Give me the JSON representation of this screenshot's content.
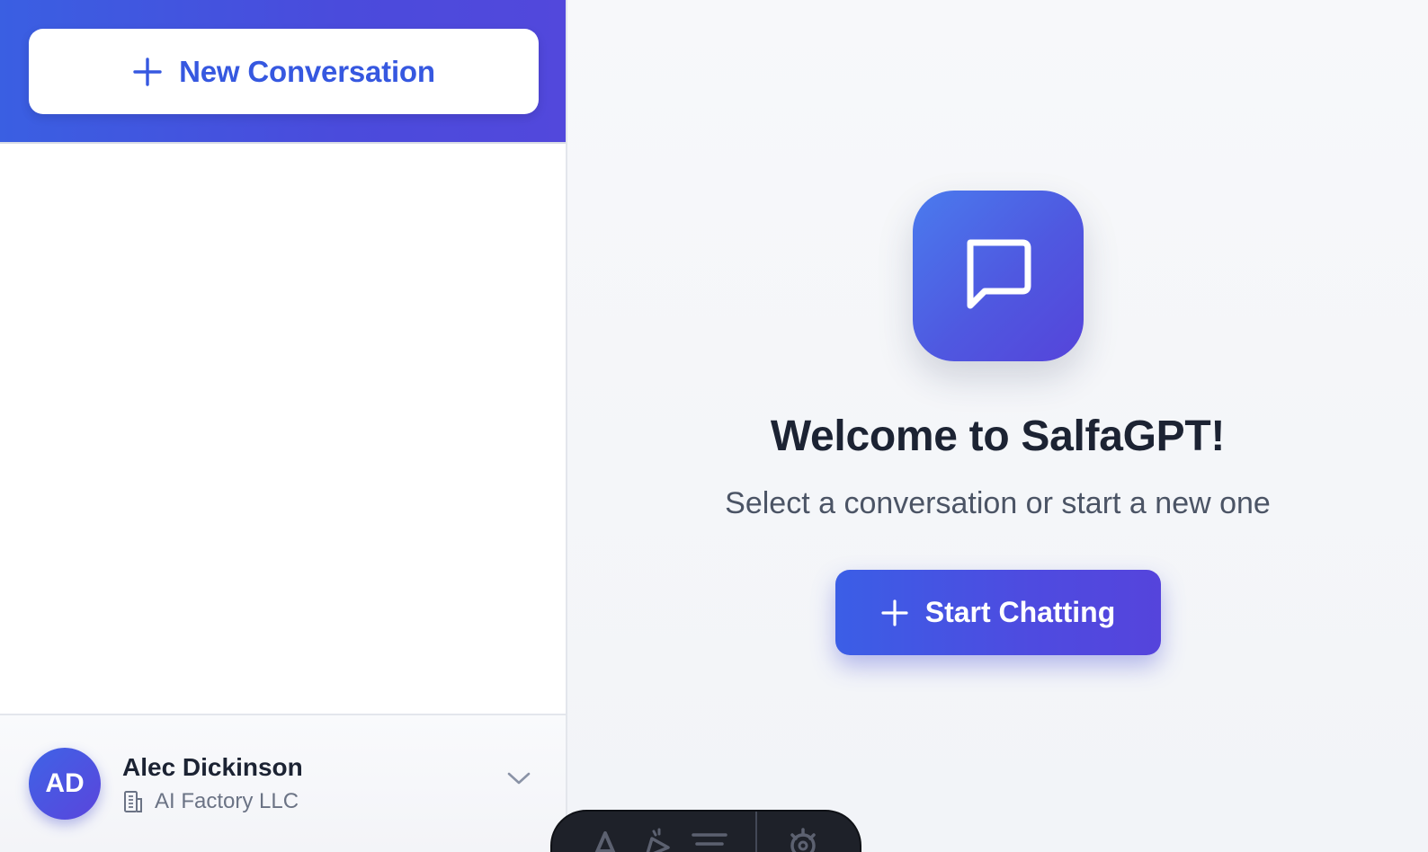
{
  "sidebar": {
    "new_conversation_label": "New Conversation",
    "user": {
      "initials": "AD",
      "name": "Alec Dickinson",
      "organization": "AI Factory LLC"
    }
  },
  "main": {
    "welcome_title": "Welcome to SalfaGPT!",
    "welcome_subtitle": "Select a conversation or start a new one",
    "start_button_label": "Start Chatting"
  },
  "icons": {
    "new_conversation": "plus-icon",
    "start_chatting": "plus-icon",
    "logo": "chat-bubble-icon",
    "organization": "building-icon",
    "user_menu": "chevron-down-icon",
    "toolbar": [
      "text-icon",
      "pen-icon",
      "menu-icon",
      "settings-icon"
    ]
  },
  "colors": {
    "accent": "#3658e0",
    "accent_gradient_end": "#5544da",
    "title_text": "#1c2333",
    "muted_text": "#6b7385",
    "toolbar_bg": "#1e2129"
  }
}
